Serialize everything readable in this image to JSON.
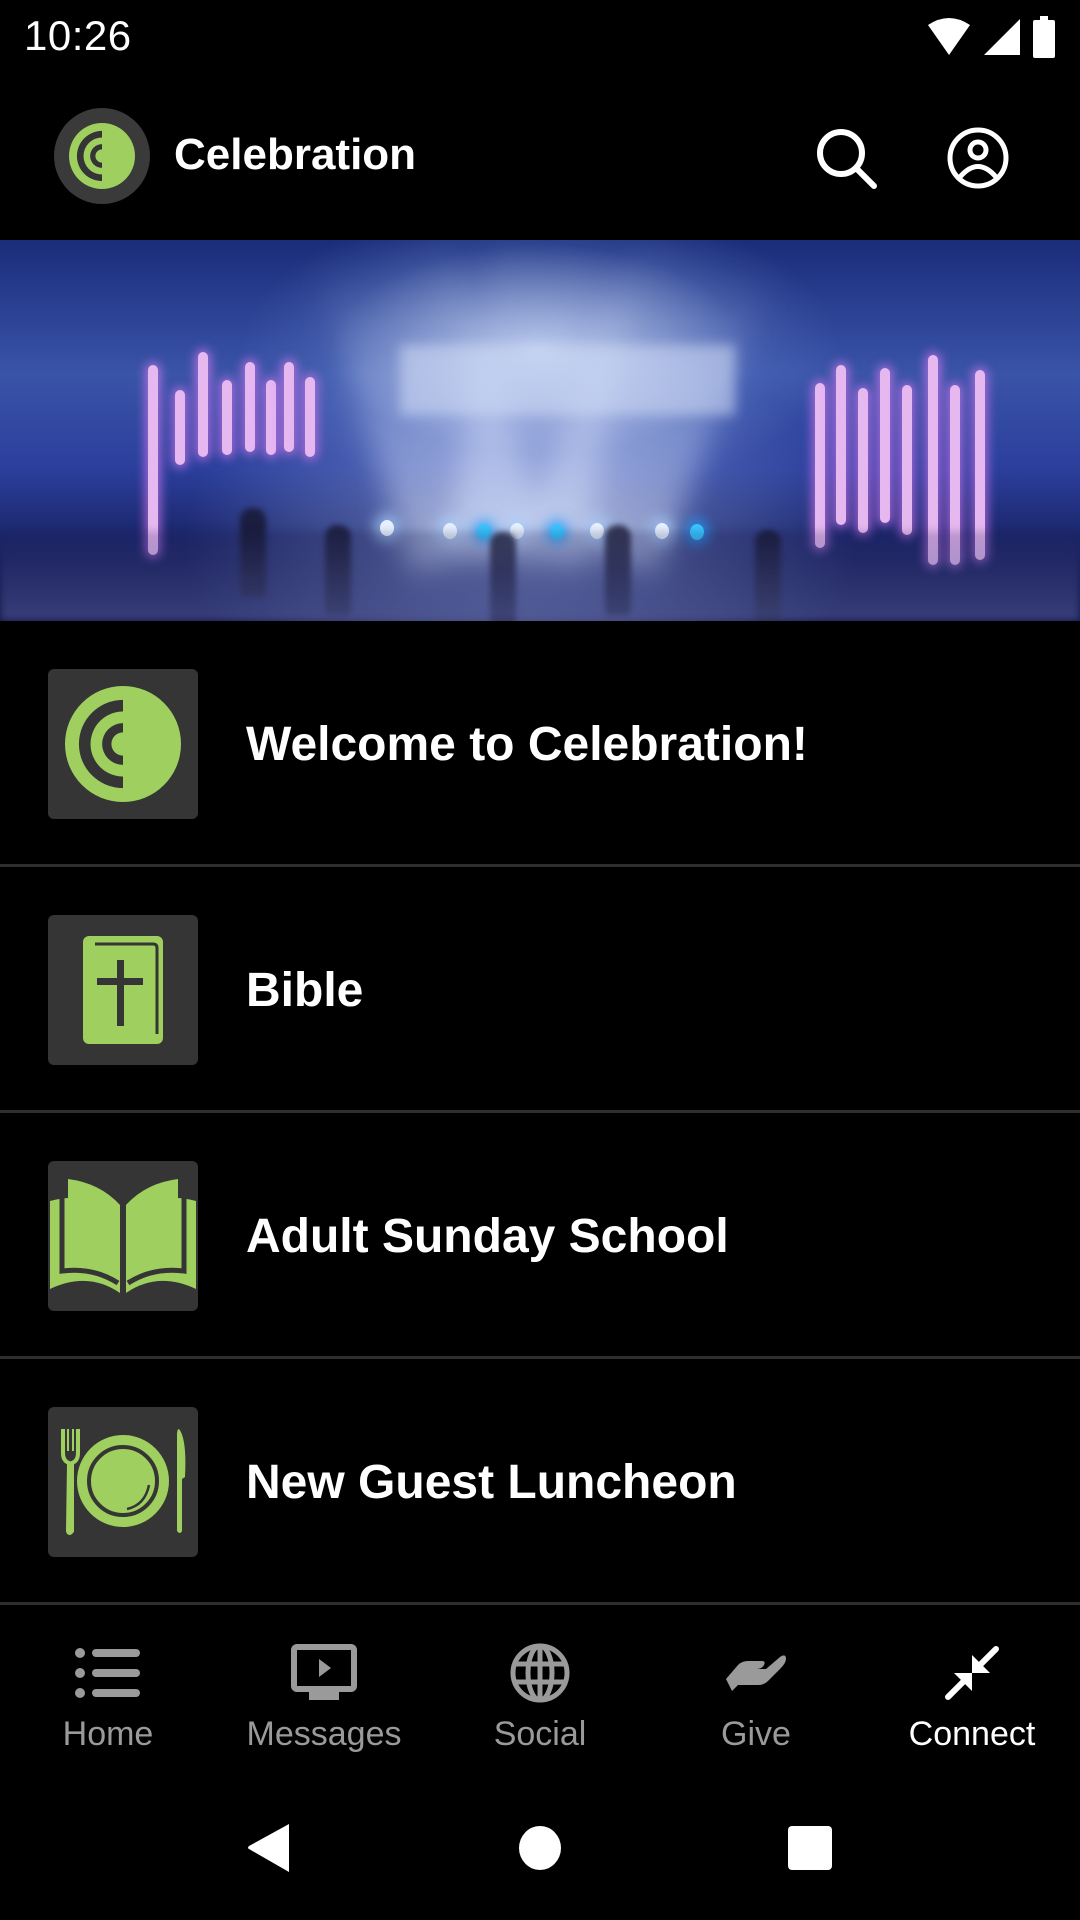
{
  "status_bar": {
    "time": "10:26",
    "icons": [
      "wifi-icon",
      "cellular-signal-icon",
      "battery-icon"
    ]
  },
  "app_bar": {
    "title": "Celebration",
    "logo_icon": "celebration-logo-icon",
    "actions": [
      {
        "name": "search",
        "icon": "search-icon"
      },
      {
        "name": "account",
        "icon": "account-circle-icon"
      }
    ]
  },
  "banner": {
    "description": "Blurred worship stage with blue lights and pink vertical light bars"
  },
  "list": {
    "items": [
      {
        "label": "Welcome to Celebration!",
        "icon": "celebration-logo-icon"
      },
      {
        "label": "Bible",
        "icon": "bible-icon"
      },
      {
        "label": "Adult Sunday School",
        "icon": "open-book-icon"
      },
      {
        "label": "New Guest Luncheon",
        "icon": "plate-cutlery-icon"
      }
    ]
  },
  "bottom_nav": {
    "active": "Connect",
    "items": [
      {
        "label": "Home",
        "icon": "list-icon"
      },
      {
        "label": "Messages",
        "icon": "video-play-icon"
      },
      {
        "label": "Social",
        "icon": "globe-icon"
      },
      {
        "label": "Give",
        "icon": "giving-hand-icon"
      },
      {
        "label": "Connect",
        "icon": "connect-arrows-icon"
      }
    ]
  },
  "system_nav": {
    "buttons": [
      "back",
      "home",
      "recents"
    ]
  },
  "colors": {
    "accent_green": "#9fcf5e",
    "tile_background": "#353535",
    "background": "#000000",
    "inactive_nav": "#9a9a9a",
    "active_nav": "#ffffff",
    "divider": "#2e2e2e"
  }
}
